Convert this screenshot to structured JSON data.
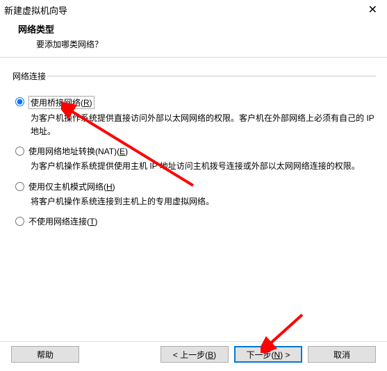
{
  "window": {
    "title": "新建虚拟机向导"
  },
  "header": {
    "title": "网络类型",
    "subtitle": "要添加哪类网络？"
  },
  "group": {
    "legend": "网络连接"
  },
  "options": {
    "bridged": {
      "label_pre": "使用桥接网络(",
      "mnemonic": "R",
      "label_post": ")",
      "desc": "为客户机操作系统提供直接访问外部以太网网络的权限。客户机在外部网络上必须有自己的 IP 地址。"
    },
    "nat": {
      "label_pre": "使用网络地址转换(NAT)(",
      "mnemonic": "E",
      "label_post": ")",
      "desc": "为客户机操作系统提供使用主机 IP 地址访问主机拨号连接或外部以太网网络连接的权限。"
    },
    "hostonly": {
      "label_pre": "使用仅主机模式网络(",
      "mnemonic": "H",
      "label_post": ")",
      "desc": "将客户机操作系统连接到主机上的专用虚拟网络。"
    },
    "none": {
      "label_pre": "不使用网络连接(",
      "mnemonic": "T",
      "label_post": ")"
    }
  },
  "buttons": {
    "help": "帮助",
    "back_pre": "< 上一步(",
    "back_mn": "B",
    "back_post": ")",
    "next_pre": "下一步(",
    "next_mn": "N",
    "next_post": ") >",
    "cancel": "取消"
  },
  "annotation": {
    "color": "#ff0000"
  }
}
